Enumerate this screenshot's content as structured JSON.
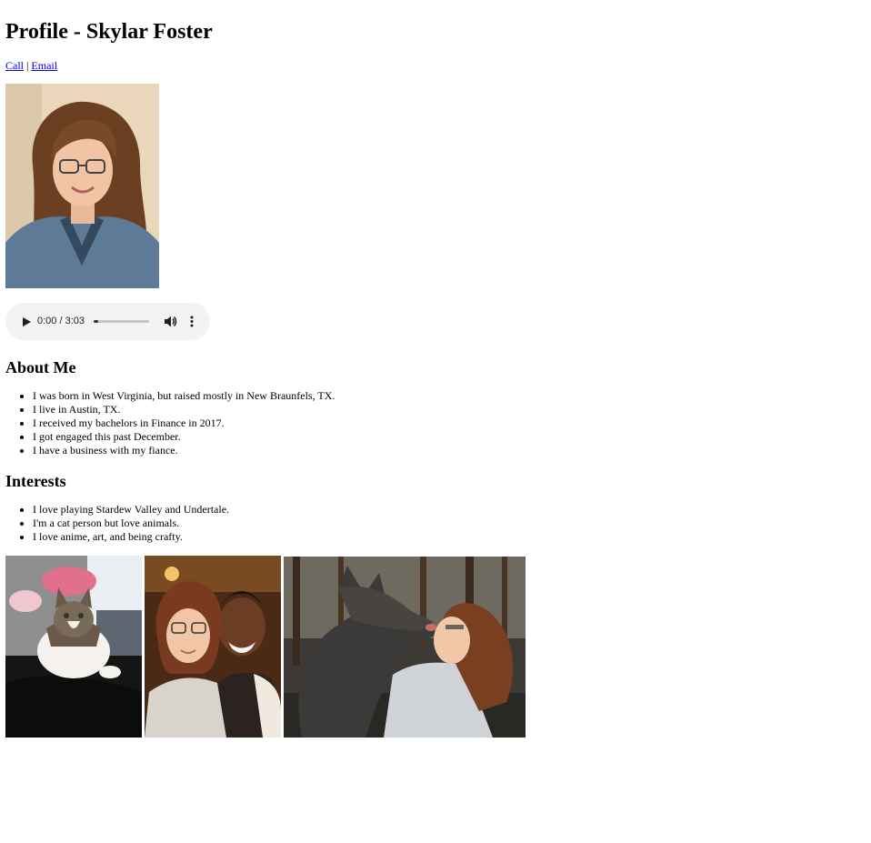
{
  "page": {
    "title": "Profile - Skylar Foster"
  },
  "links": {
    "call": "Call",
    "separator": "|",
    "email": "Email"
  },
  "portrait": {
    "icon": "profile-photo-icon"
  },
  "audio": {
    "time_display": "0:00 / 3:03",
    "progress": 0.0,
    "play_icon": "play-icon",
    "volume_icon": "volume-icon",
    "more_icon": "more-options-icon"
  },
  "about": {
    "heading": "About Me",
    "items": [
      "I was born in West Virginia, but raised mostly in New Braunfels, TX.",
      "I live in Austin, TX.",
      "I received my bachelors in Finance in 2017.",
      "I got engaged this past December.",
      "I have a business with my fiance."
    ]
  },
  "interests": {
    "heading": "Interests",
    "items": [
      "I love playing Stardew Valley and Undertale.",
      "I'm a cat person but love animals.",
      "I love anime, art, and being crafty."
    ]
  },
  "colors": {
    "link": "#0000ee",
    "audio_background": "#f1f3f4"
  }
}
